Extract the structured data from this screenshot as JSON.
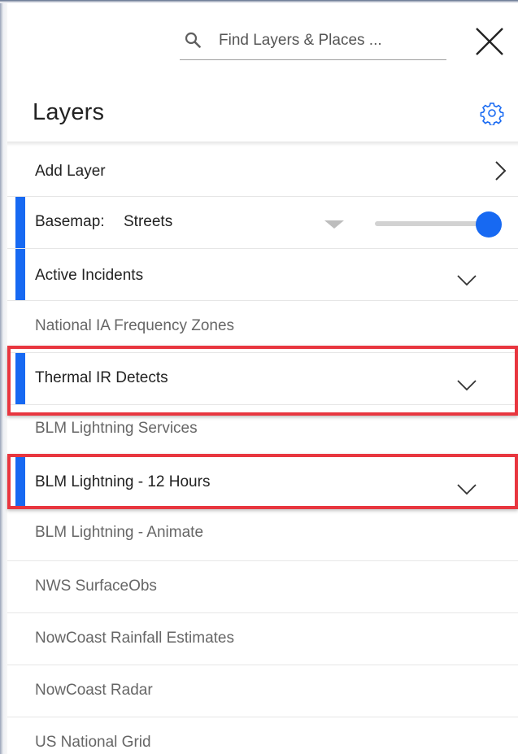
{
  "search": {
    "placeholder": "Find Layers & Places ..."
  },
  "title": "Layers",
  "add_layer": {
    "label": "Add Layer"
  },
  "basemap": {
    "label": "Basemap:",
    "value": "Streets",
    "opacity_fraction": 1.0
  },
  "layers": [
    {
      "label": "Active Incidents",
      "active": true,
      "expandable": true
    },
    {
      "label": "National IA Frequency Zones",
      "active": false,
      "expandable": false
    },
    {
      "label": "Thermal IR Detects",
      "active": true,
      "expandable": true,
      "highlighted": true
    },
    {
      "label": "BLM Lightning Services",
      "active": false,
      "expandable": false
    },
    {
      "label": "BLM Lightning - 12 Hours",
      "active": true,
      "expandable": true,
      "highlighted": true
    },
    {
      "label": "BLM Lightning - Animate",
      "active": false,
      "expandable": false
    },
    {
      "label": "NWS SurfaceObs",
      "active": false,
      "expandable": false
    },
    {
      "label": "NowCoast Rainfall Estimates",
      "active": false,
      "expandable": false
    },
    {
      "label": "NowCoast Radar",
      "active": false,
      "expandable": false
    },
    {
      "label": "US National Grid",
      "active": false,
      "expandable": false
    }
  ],
  "colors": {
    "accent": "#1769f2",
    "highlight": "#e8363f"
  },
  "icons": {
    "search": "search-icon",
    "close": "close-icon",
    "settings": "gear-icon",
    "add": "chevron-right-icon",
    "expand": "chevron-down-icon"
  }
}
